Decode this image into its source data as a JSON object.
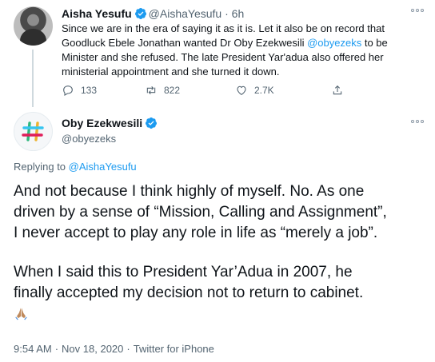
{
  "parent_tweet": {
    "display_name": "Aisha Yesufu",
    "handle": "@AishaYesufu",
    "separator": "·",
    "time": "6h",
    "text_before_mention": "Since we are in the era of saying it as it is. Let it also be on record that Goodluck Ebele Jonathan wanted Dr Oby Ezekwesili ",
    "mention": "@obyezeks",
    "text_after_mention": " to be Minister and she refused. The late President Yar'adua also offered her ministerial appointment and she turned it down.",
    "replies": "133",
    "retweets": "822",
    "likes": "2.7K",
    "icons": {
      "reply": "reply-icon",
      "retweet": "retweet-icon",
      "like": "heart-icon",
      "share": "share-icon",
      "more": "more-icon",
      "verified": "verified-badge-icon"
    }
  },
  "main_tweet": {
    "display_name": "Oby Ezekwesili",
    "handle": "@obyezeks",
    "replying_to_label": "Replying to",
    "replying_to_handle": "@AishaYesufu",
    "paragraph1": "And not because I think highly of myself. No. As one\ndriven by a sense of “Mission, Calling and Assignment”,\nI never accept to play any role in life as “merely a job”.",
    "paragraph2": "When I said this to President Yar’Adua in 2007, he\nfinally accepted my decision not to return to cabinet.",
    "emoji": "folded-hands-emoji",
    "time": "9:54 AM",
    "date": "Nov 18, 2020",
    "source": "Twitter for iPhone",
    "separator": "·"
  },
  "colors": {
    "link": "#1d9bf0",
    "verified": "#1d9bf0",
    "secondary_text": "#536471",
    "primary_text": "#0f1419",
    "hashtag_green": "#2eb67d",
    "hashtag_red": "#e01e5a",
    "hashtag_yellow": "#ecb22e",
    "hashtag_blue": "#36c5f0"
  }
}
